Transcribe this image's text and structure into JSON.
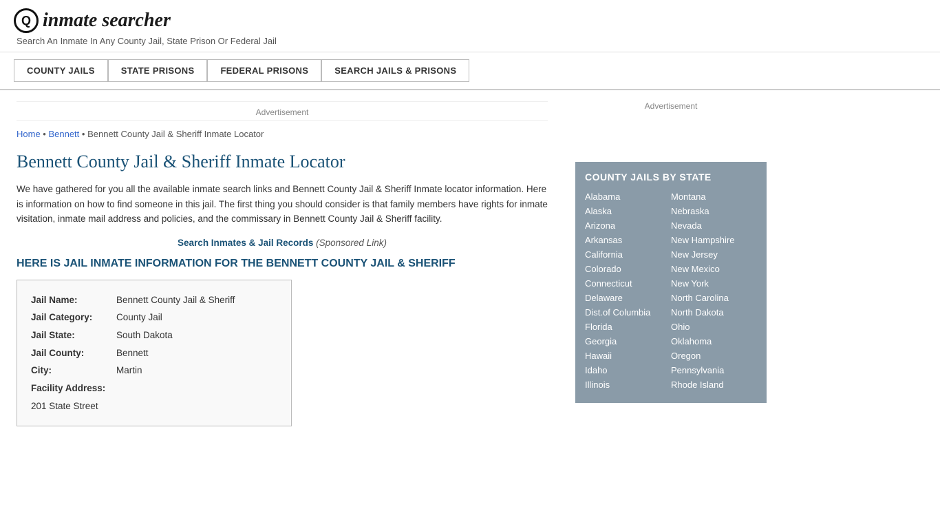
{
  "header": {
    "logo_icon": "🔍",
    "logo_text": "inmate searcher",
    "tagline": "Search An Inmate In Any County Jail, State Prison Or Federal Jail"
  },
  "nav": {
    "items": [
      {
        "label": "COUNTY JAILS",
        "id": "county-jails"
      },
      {
        "label": "STATE PRISONS",
        "id": "state-prisons"
      },
      {
        "label": "FEDERAL PRISONS",
        "id": "federal-prisons"
      },
      {
        "label": "SEARCH JAILS & PRISONS",
        "id": "search-jails"
      }
    ]
  },
  "ads": {
    "banner": "Advertisement",
    "sidebar": "Advertisement"
  },
  "breadcrumb": {
    "home": "Home",
    "separator1": " • ",
    "bennett": "Bennett",
    "separator2": " • ",
    "current": "Bennett County Jail & Sheriff Inmate Locator"
  },
  "page": {
    "title": "Bennett County Jail & Sheriff Inmate Locator",
    "intro": "We have gathered for you all the available inmate search links and Bennett County Jail & Sheriff Inmate locator information. Here is information on how to find someone in this jail. The first thing you should consider is that family members have rights for inmate visitation, inmate mail address and policies, and the commissary in Bennett County Jail & Sheriff facility.",
    "search_link_text": "Search Inmates & Jail Records",
    "search_link_sponsored": "(Sponsored Link)",
    "info_heading": "HERE IS JAIL INMATE INFORMATION FOR THE BENNETT COUNTY JAIL & SHERIFF"
  },
  "jail_info": {
    "jail_name_label": "Jail Name:",
    "jail_name_value": "Bennett County Jail & Sheriff",
    "jail_category_label": "Jail Category:",
    "jail_category_value": "County Jail",
    "jail_state_label": "Jail State:",
    "jail_state_value": "South Dakota",
    "jail_county_label": "Jail County:",
    "jail_county_value": "Bennett",
    "city_label": "City:",
    "city_value": "Martin",
    "facility_address_label": "Facility Address:",
    "facility_address_value": "201 State Street"
  },
  "sidebar": {
    "county_jails_title": "COUNTY JAILS BY STATE",
    "states_left": [
      "Alabama",
      "Alaska",
      "Arizona",
      "Arkansas",
      "California",
      "Colorado",
      "Connecticut",
      "Delaware",
      "Dist.of Columbia",
      "Florida",
      "Georgia",
      "Hawaii",
      "Idaho",
      "Illinois"
    ],
    "states_right": [
      "Montana",
      "Nebraska",
      "Nevada",
      "New Hampshire",
      "New Jersey",
      "New Mexico",
      "New York",
      "North Carolina",
      "North Dakota",
      "Ohio",
      "Oklahoma",
      "Oregon",
      "Pennsylvania",
      "Rhode Island"
    ]
  }
}
